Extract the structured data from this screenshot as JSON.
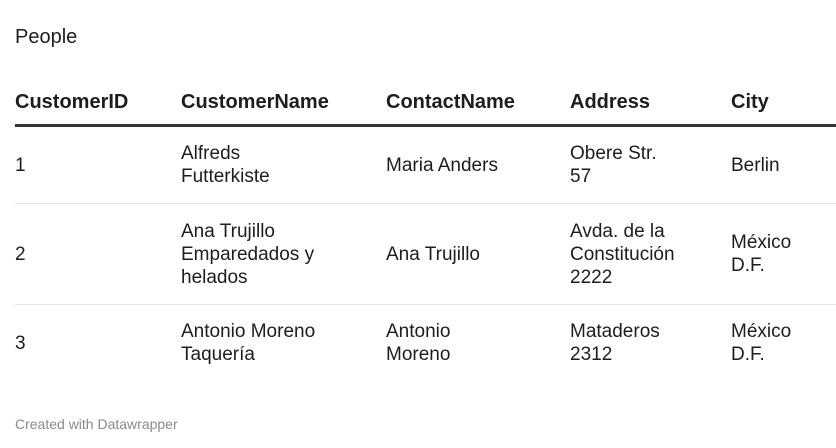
{
  "title": "People",
  "table": {
    "headers": [
      "CustomerID",
      "CustomerName",
      "ContactName",
      "Address",
      "City"
    ],
    "rows": [
      [
        "1",
        "Alfreds\nFutterkiste",
        "Maria Anders",
        "Obere Str.\n57",
        "Berlin"
      ],
      [
        "2",
        "Ana Trujillo\nEmparedados y\nhelados",
        "Ana Trujillo",
        "Avda. de la\nConstitución\n2222",
        "México\nD.F."
      ],
      [
        "3",
        "Antonio Moreno\nTaquería",
        "Antonio\nMoreno",
        "Mataderos\n2312",
        "México\nD.F."
      ]
    ]
  },
  "footer": "Created with Datawrapper"
}
